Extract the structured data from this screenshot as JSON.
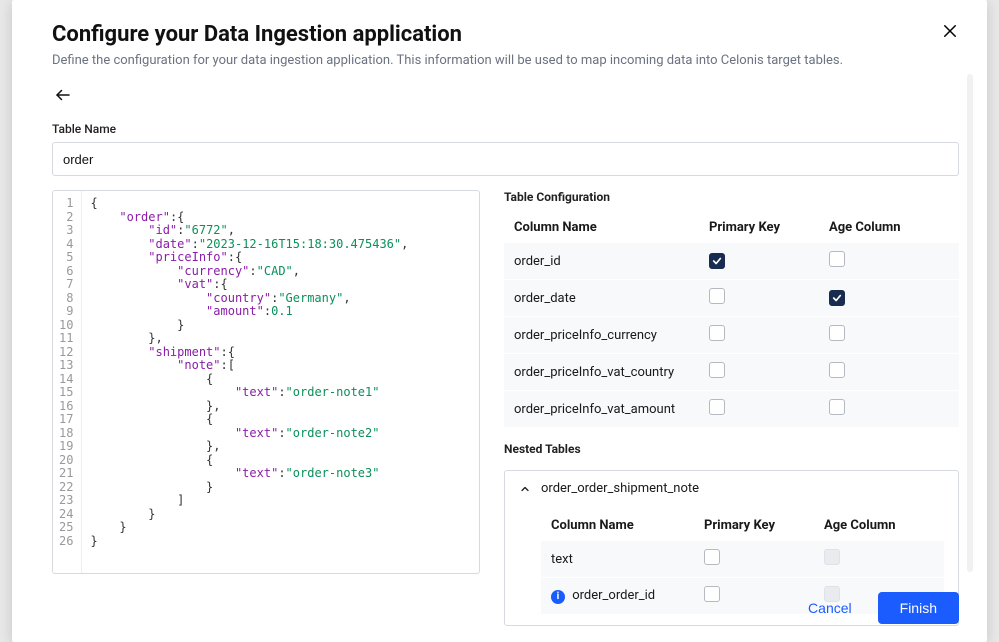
{
  "header": {
    "title": "Configure your Data Ingestion application",
    "subtitle": "Define the configuration for your data ingestion application. This information will be used to map incoming data into Celonis target tables."
  },
  "form": {
    "table_name_label": "Table Name",
    "table_name_value": "order"
  },
  "code": {
    "lines": [
      "{",
      "    \"order\": {",
      "        \"id\": \"6772\",",
      "        \"date\": \"2023-12-16T15:18:30.475436\",",
      "        \"priceInfo\": {",
      "            \"currency\": \"CAD\",",
      "            \"vat\": {",
      "                \"country\": \"Germany\",",
      "                \"amount\": 0.1",
      "            }",
      "        },",
      "        \"shipment\": {",
      "            \"note\": [",
      "                {",
      "                    \"text\": \"order-note1\"",
      "                },",
      "                {",
      "                    \"text\": \"order-note2\"",
      "                },",
      "                {",
      "                    \"text\": \"order-note3\"",
      "                }",
      "            ]",
      "        }",
      "    }",
      "}"
    ]
  },
  "tableConfig": {
    "section_label": "Table Configuration",
    "col_name": "Column Name",
    "col_pk": "Primary Key",
    "col_age": "Age Column",
    "rows": [
      {
        "name": "order_id",
        "pk": true,
        "age": false
      },
      {
        "name": "order_date",
        "pk": false,
        "age": true
      },
      {
        "name": "order_priceInfo_currency",
        "pk": false,
        "age": false
      },
      {
        "name": "order_priceInfo_vat_country",
        "pk": false,
        "age": false
      },
      {
        "name": "order_priceInfo_vat_amount",
        "pk": false,
        "age": false
      }
    ]
  },
  "nested": {
    "section_label": "Nested Tables",
    "table_name": "order_order_shipment_note",
    "col_name": "Column Name",
    "col_pk": "Primary Key",
    "col_age": "Age Column",
    "rows": [
      {
        "name": "text",
        "pk": false,
        "age": false,
        "age_disabled": true,
        "info": false
      },
      {
        "name": "order_order_id",
        "pk": false,
        "age": false,
        "age_disabled": true,
        "info": true
      }
    ]
  },
  "footer": {
    "cancel": "Cancel",
    "finish": "Finish"
  }
}
